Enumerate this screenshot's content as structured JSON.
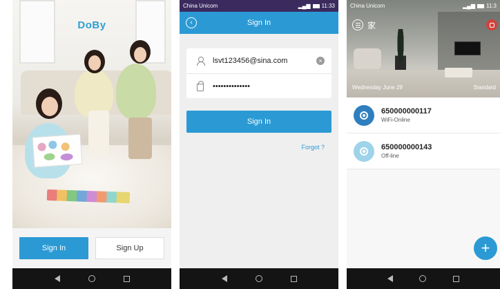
{
  "screens": {
    "welcome": {
      "logo": "DoBy",
      "sign_in_label": "Sign In",
      "sign_up_label": "Sign Up"
    },
    "signin": {
      "status": {
        "carrier": "China Unicom",
        "time": "11:33"
      },
      "title": "Sign In",
      "email_value": "lsvt123456@sina.com",
      "password_value": "••••••••••••••",
      "sign_in_button": "Sign In",
      "forgot_link": "Forgot ?"
    },
    "home": {
      "status": {
        "carrier": "China Unicom",
        "time": "11:3"
      },
      "title": "家",
      "date": "Wednesday June 29",
      "mode": "Standard",
      "devices": [
        {
          "name": "650000000117",
          "status": "WiFi-Online",
          "state": "online"
        },
        {
          "name": "650000000143",
          "status": "Off-line",
          "state": "offline"
        }
      ],
      "add_button": "+"
    }
  },
  "colors": {
    "accent": "#2b9ad4",
    "device_online": "#2f7fbf",
    "device_offline": "#9fd3ea",
    "status_bar_purple": "#3a2a5e",
    "nav_bar": "#141414"
  },
  "icons": [
    "back-icon",
    "user-icon",
    "lock-icon",
    "clear-icon",
    "menu-icon",
    "camera-icon",
    "device-camera-icon",
    "add-icon",
    "nav-back-icon",
    "nav-home-icon",
    "nav-recents-icon"
  ]
}
